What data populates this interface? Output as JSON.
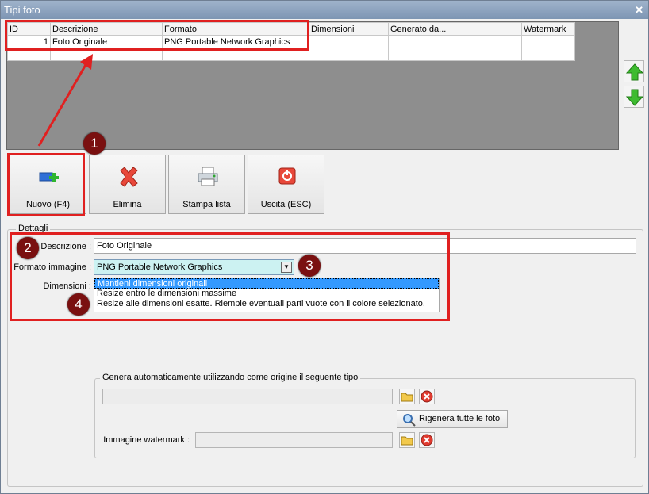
{
  "window": {
    "title": "Tipi foto",
    "close_glyph": "✕"
  },
  "grid": {
    "columns": [
      "ID",
      "Descrizione",
      "Formato",
      "Dimensioni",
      "Generato da...",
      "Watermark"
    ],
    "rows": [
      {
        "id": "1",
        "descrizione": "Foto Originale",
        "formato": "PNG Portable Network Graphics",
        "dimensioni": "",
        "generato": "",
        "watermark": ""
      }
    ]
  },
  "toolbar": {
    "nuovo": "Nuovo (F4)",
    "elimina": "Elimina",
    "stampa": "Stampa lista",
    "uscita": "Uscita (ESC)"
  },
  "annotations": {
    "b1": "1",
    "b2": "2",
    "b3": "3",
    "b4": "4",
    "color": "#e02020"
  },
  "details": {
    "legend": "Dettagli",
    "descrizione_label": "Descrizione :",
    "descrizione_value": "Foto Originale",
    "formato_label": "Formato immagine :",
    "formato_value": "PNG Portable Network Graphics",
    "dimensioni_label": "Dimensioni :",
    "dimensioni_options": [
      "Mantieni dimensioni originali",
      "Resize entro le dimensioni massime",
      "Resize alle dimensioni esatte. Riempie eventuali parti vuote con il colore selezionato."
    ],
    "dimensioni_selected": 0
  },
  "generate": {
    "legend": "Genera automaticamente utilizzando come origine il seguente tipo",
    "origin_value": "",
    "regen_label": "Rigenera tutte le foto",
    "watermark_label": "Immagine watermark :",
    "watermark_value": ""
  },
  "icons": [
    "close-icon",
    "arrow-up-icon",
    "arrow-down-icon",
    "new-record-icon",
    "delete-x-icon",
    "printer-icon",
    "exit-power-icon",
    "dropdown-arrow-icon",
    "folder-icon",
    "clear-icon",
    "regenerate-icon"
  ]
}
